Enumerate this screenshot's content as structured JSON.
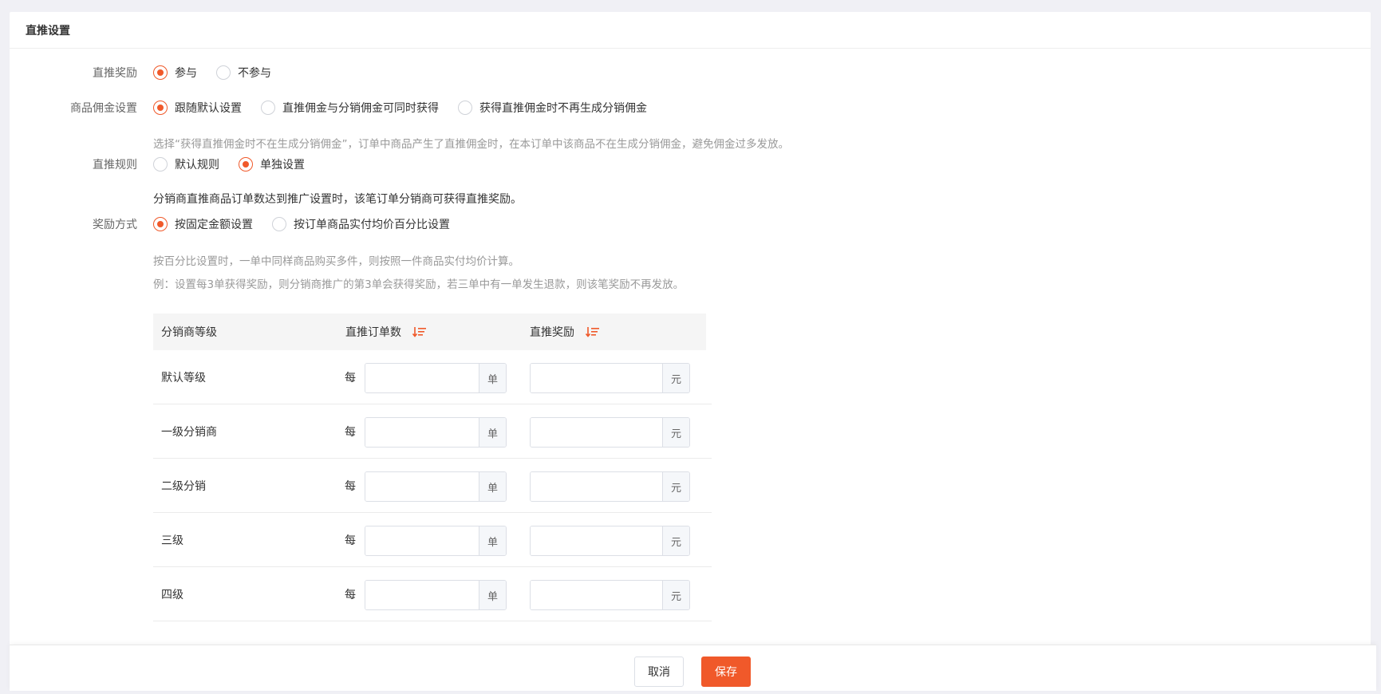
{
  "header": {
    "title": "直推设置"
  },
  "form": {
    "reward": {
      "label": "直推奖励",
      "options": [
        {
          "label": "参与",
          "checked": true
        },
        {
          "label": "不参与",
          "checked": false
        }
      ]
    },
    "commission": {
      "label": "商品佣金设置",
      "options": [
        {
          "label": "跟随默认设置",
          "checked": true
        },
        {
          "label": "直推佣金与分销佣金可同时获得",
          "checked": false
        },
        {
          "label": "获得直推佣金时不再生成分销佣金",
          "checked": false
        }
      ],
      "hint": "选择“获得直推佣金时不在生成分销佣金”，订单中商品产生了直推佣金时，在本订单中该商品不在生成分销佣金，避免佣金过多发放。"
    },
    "rule": {
      "label": "直推规则",
      "options": [
        {
          "label": "默认规则",
          "checked": false
        },
        {
          "label": "单独设置",
          "checked": true
        }
      ],
      "note": "分销商直推商品订单数达到推广设置时，该笔订单分销商可获得直推奖励。"
    },
    "method": {
      "label": "奖励方式",
      "options": [
        {
          "label": "按固定金额设置",
          "checked": true
        },
        {
          "label": "按订单商品实付均价百分比设置",
          "checked": false
        }
      ],
      "hint1": "按百分比设置时，一单中同样商品购买多件，则按照一件商品实付均价计算。",
      "hint2": "例：设置每3单获得奖励，则分销商推广的第3单会获得奖励，若三单中有一单发生退款，则该笔奖励不再发放。"
    }
  },
  "table": {
    "headers": {
      "level": "分销商等级",
      "orders": "直推订单数",
      "reward": "直推奖励"
    },
    "every": "每",
    "order_unit": "单",
    "reward_unit": "元",
    "rows": [
      {
        "level": "默认等级",
        "orders": "",
        "reward": ""
      },
      {
        "level": "一级分销商",
        "orders": "",
        "reward": ""
      },
      {
        "level": "二级分销",
        "orders": "",
        "reward": ""
      },
      {
        "level": "三级",
        "orders": "",
        "reward": ""
      },
      {
        "level": "四级",
        "orders": "",
        "reward": ""
      }
    ]
  },
  "footer": {
    "cancel": "取消",
    "save": "保存"
  },
  "colors": {
    "accent": "#f0592a",
    "sort_icon": "sort-descending-icon"
  }
}
